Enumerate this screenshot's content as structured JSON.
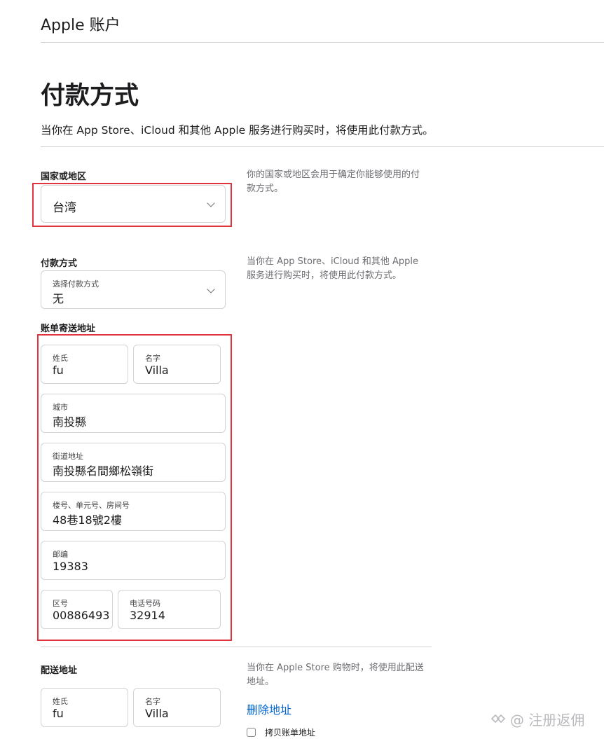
{
  "header": {
    "title": "Apple 账户"
  },
  "page": {
    "title": "付款方式",
    "description": "当你在 App Store、iCloud 和其他 Apple 服务进行购买时，将使用此付款方式。"
  },
  "country": {
    "section_label": "国家或地区",
    "value": "台湾",
    "note": "你的国家或地区会用于确定你能够使用的付款方式。"
  },
  "payment": {
    "section_label": "付款方式",
    "select_label": "选择付款方式",
    "select_value": "无",
    "note": "当你在 App Store、iCloud 和其他 Apple 服务进行购买时，将使用此付款方式。"
  },
  "billing": {
    "section_label": "账单寄送地址",
    "last_name": {
      "label": "姓氏",
      "value": "fu"
    },
    "first_name": {
      "label": "名字",
      "value": "Villa"
    },
    "city": {
      "label": "城市",
      "value": "南投縣"
    },
    "street": {
      "label": "街道地址",
      "value": "南投縣名間鄉松嶺街"
    },
    "unit": {
      "label": "楼号、单元号、房间号",
      "value": "48巷18號2樓"
    },
    "zip": {
      "label": "邮编",
      "value": "19383"
    },
    "area_code": {
      "label": "区号",
      "value": "00886493"
    },
    "phone": {
      "label": "电话号码",
      "value": "32914"
    }
  },
  "shipping": {
    "section_label": "配送地址",
    "note": "当你在 Apple Store 购物时，将使用此配送地址。",
    "delete_link": "删除地址",
    "copy_billing_label": "拷贝账单地址",
    "last_name": {
      "label": "姓氏",
      "value": "fu"
    },
    "first_name": {
      "label": "名字",
      "value": "Villa"
    }
  },
  "watermark": {
    "icon": "share-icon",
    "text": "@ 注册返佣"
  },
  "colors": {
    "highlight": "#e2343c",
    "link": "#0066cc"
  }
}
